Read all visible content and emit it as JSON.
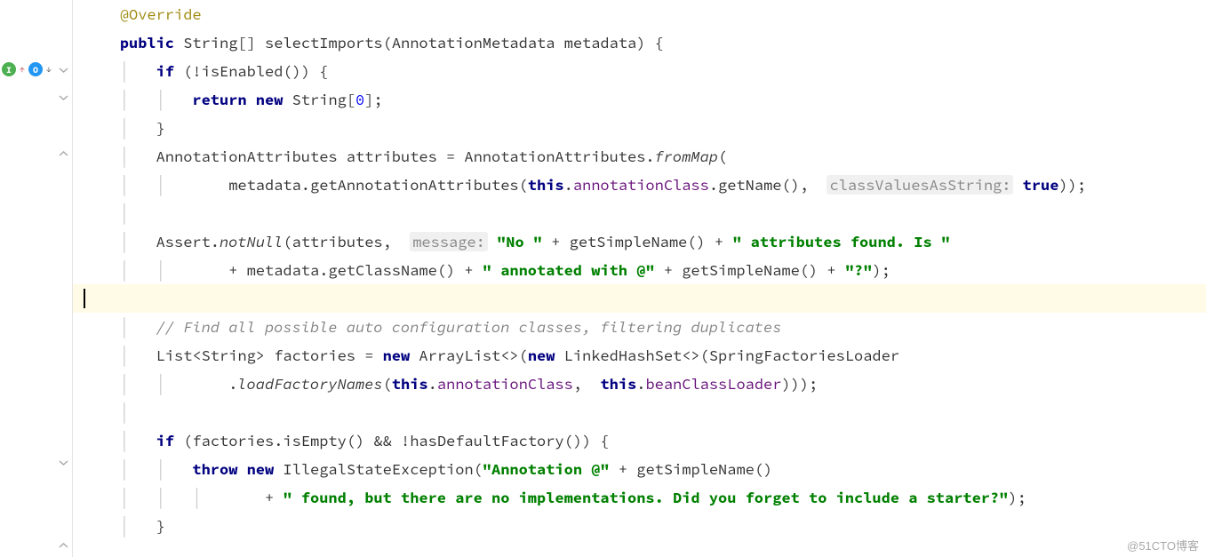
{
  "gutter": {
    "impl_badge": "I",
    "override_badge": "O"
  },
  "code": {
    "l1": "@Override",
    "l2a": "public",
    "l2b": " String[] selectImports(AnnotationMetadata metadata) {",
    "l3a": "if",
    "l3b": " (!isEnabled()) {",
    "l4a": "return new",
    "l4b": " String[",
    "l4c": "0",
    "l4d": "];",
    "l5": "}",
    "l6a": "AnnotationAttributes attributes = AnnotationAttributes.",
    "l6b": "fromMap",
    "l6c": "(",
    "l7a": "metadata.getAnnotationAttributes(",
    "l7b": "this",
    "l7c": ".",
    "l7d": "annotationClass",
    "l7e": ".getName(),  ",
    "l7f": "classValuesAsString:",
    "l7g": " ",
    "l7h": "true",
    "l7i": "));",
    "l8": "",
    "l9a": "Assert.",
    "l9b": "notNull",
    "l9c": "(attributes,  ",
    "l9d": "message:",
    "l9e": " ",
    "l9f": "\"No \"",
    "l9g": " + getSimpleName() + ",
    "l9h": "\" attributes found. Is \"",
    "l10a": "+ metadata.getClassName() + ",
    "l10b": "\" annotated with @\"",
    "l10c": " + getSimpleName() + ",
    "l10d": "\"?\"",
    "l10e": ");",
    "l11": "",
    "l12": "// Find all possible auto configuration classes, filtering duplicates",
    "l13a": "List<String> factories = ",
    "l13b": "new",
    "l13c": " ArrayList<>(",
    "l13d": "new",
    "l13e": " LinkedHashSet<>(SpringFactoriesLoader",
    "l14a": ".",
    "l14b": "loadFactoryNames",
    "l14c": "(",
    "l14d": "this",
    "l14e": ".",
    "l14f": "annotationClass",
    "l14g": ",  ",
    "l14h": "this",
    "l14i": ".",
    "l14j": "beanClassLoader",
    "l14k": ")));",
    "l15": "",
    "l16a": "if",
    "l16b": " (factories.isEmpty() && !hasDefaultFactory()) {",
    "l17a": "throw new",
    "l17b": " IllegalStateException(",
    "l17c": "\"Annotation @\"",
    "l17d": " + getSimpleName()",
    "l18a": "+ ",
    "l18b": "\" found, but there are no implementations. Did you forget to include a starter?\"",
    "l18c": ");",
    "l19": "}"
  },
  "watermark": "@51CTO博客"
}
